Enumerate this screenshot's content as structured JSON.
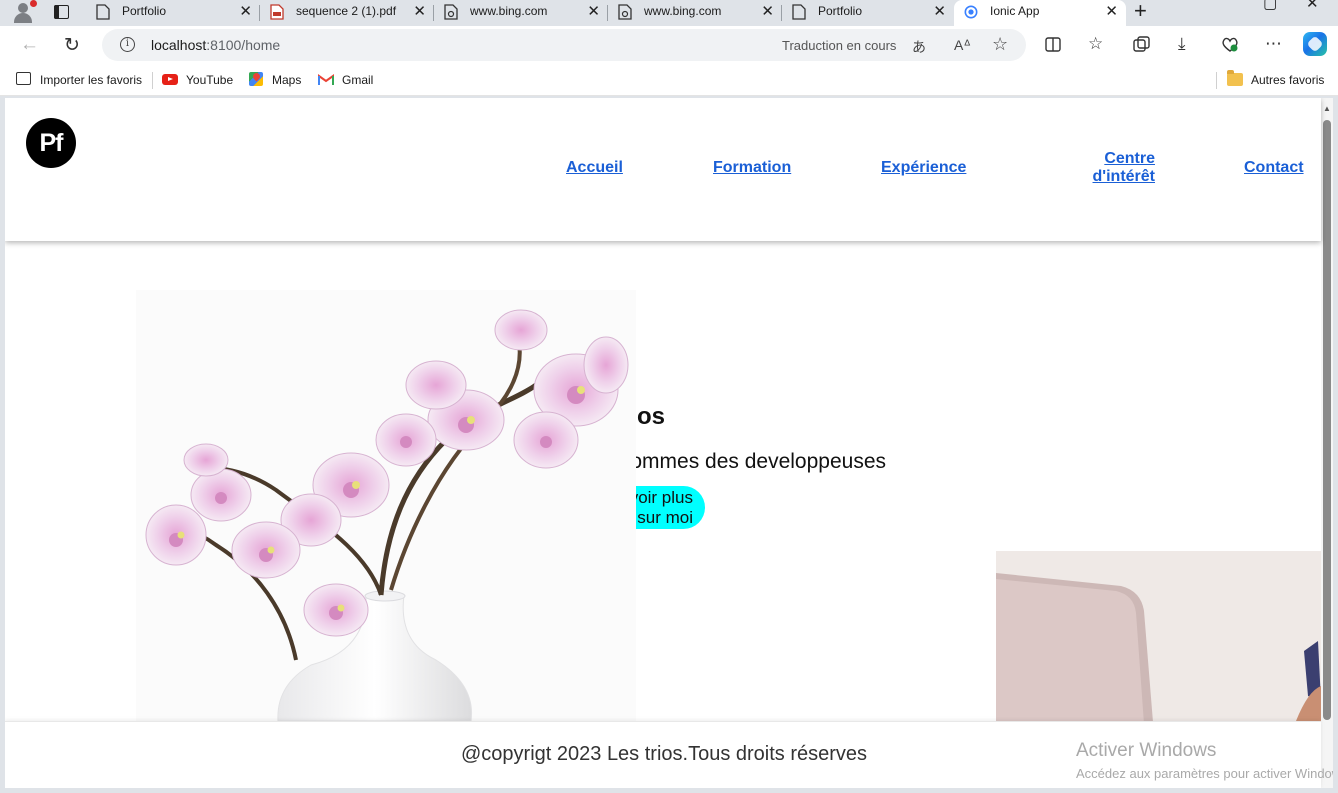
{
  "browser": {
    "tabs": [
      {
        "label": "Portfolio",
        "icon": "page-icon",
        "active": false
      },
      {
        "label": "sequence 2 (1).pdf",
        "icon": "pdf-icon",
        "active": false
      },
      {
        "label": "www.bing.com",
        "icon": "bing-page-icon",
        "active": false
      },
      {
        "label": "www.bing.com",
        "icon": "bing-page-icon",
        "active": false
      },
      {
        "label": "Portfolio",
        "icon": "page-icon",
        "active": false
      },
      {
        "label": "Ionic App",
        "icon": "ionic-icon",
        "active": true
      }
    ],
    "close_glyph": "✕",
    "new_tab_glyph": "+",
    "url_host": "localhost",
    "url_path": ":8100/home",
    "translating": "Traduction en cours",
    "bookmarks": {
      "import": "Importer les favoris",
      "youtube": "YouTube",
      "maps": "Maps",
      "gmail": "Gmail",
      "other": "Autres favoris"
    }
  },
  "app": {
    "logo": "Pf",
    "nav": {
      "accueil": "Accueil",
      "formation": "Formation",
      "experience": "Expérience",
      "centre_line1": "Centre",
      "centre_line2": "d'intérêt",
      "contact": "Contact"
    },
    "hero": {
      "title": "Les trios",
      "subtitle": "Nous sommes des developpeuses",
      "button": "En savoir plus sur moi"
    },
    "footer": "@copyrigt 2023 Les trios.Tous droits réserves"
  },
  "os_watermark": {
    "title": "Activer Windows",
    "subtitle": "Accédez aux paramètres pour activer Windows."
  },
  "colors": {
    "nav_link": "#1a5fd6",
    "hero_button": "#00ffff",
    "logo_bg": "#000000"
  }
}
